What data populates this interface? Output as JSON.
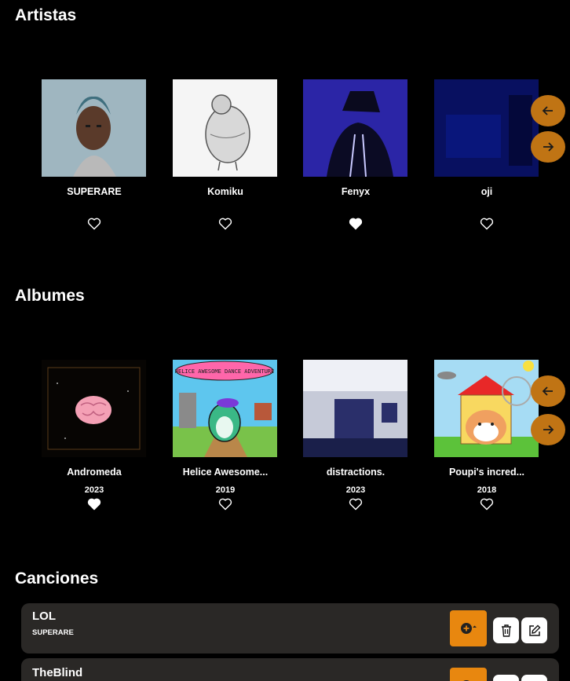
{
  "sections": {
    "artists_title": "Artistas",
    "albums_title": "Albumes",
    "songs_title": "Canciones"
  },
  "artists": [
    {
      "name": "SUPERARE",
      "liked": false
    },
    {
      "name": "Komiku",
      "liked": false
    },
    {
      "name": "Fenyx",
      "liked": true
    },
    {
      "name": "oji",
      "liked": false
    }
  ],
  "albums": [
    {
      "name": "Andromeda",
      "year": "2023",
      "liked": true
    },
    {
      "name": "Helice Awesome...",
      "year": "2019",
      "liked": false
    },
    {
      "name": "distractions.",
      "year": "2023",
      "liked": false
    },
    {
      "name": "Poupi's incred...",
      "year": "2018",
      "liked": false
    }
  ],
  "album_art_text": {
    "helice_banner": "HELICE AWESOME DANCE ADVENTURE"
  },
  "songs": [
    {
      "title": "LOL",
      "artist": "SUPERARE"
    },
    {
      "title": "TheBlind",
      "artist": ""
    }
  ],
  "colors": {
    "accent": "#e8870f",
    "nav_button": "#c07414",
    "song_card": "#2a2826",
    "background": "#000000"
  },
  "icons": {
    "prev": "arrow-left-icon",
    "next": "arrow-right-icon",
    "like": "heart-icon",
    "add": "add-to-playlist-icon",
    "delete": "trash-icon",
    "edit": "edit-icon"
  }
}
